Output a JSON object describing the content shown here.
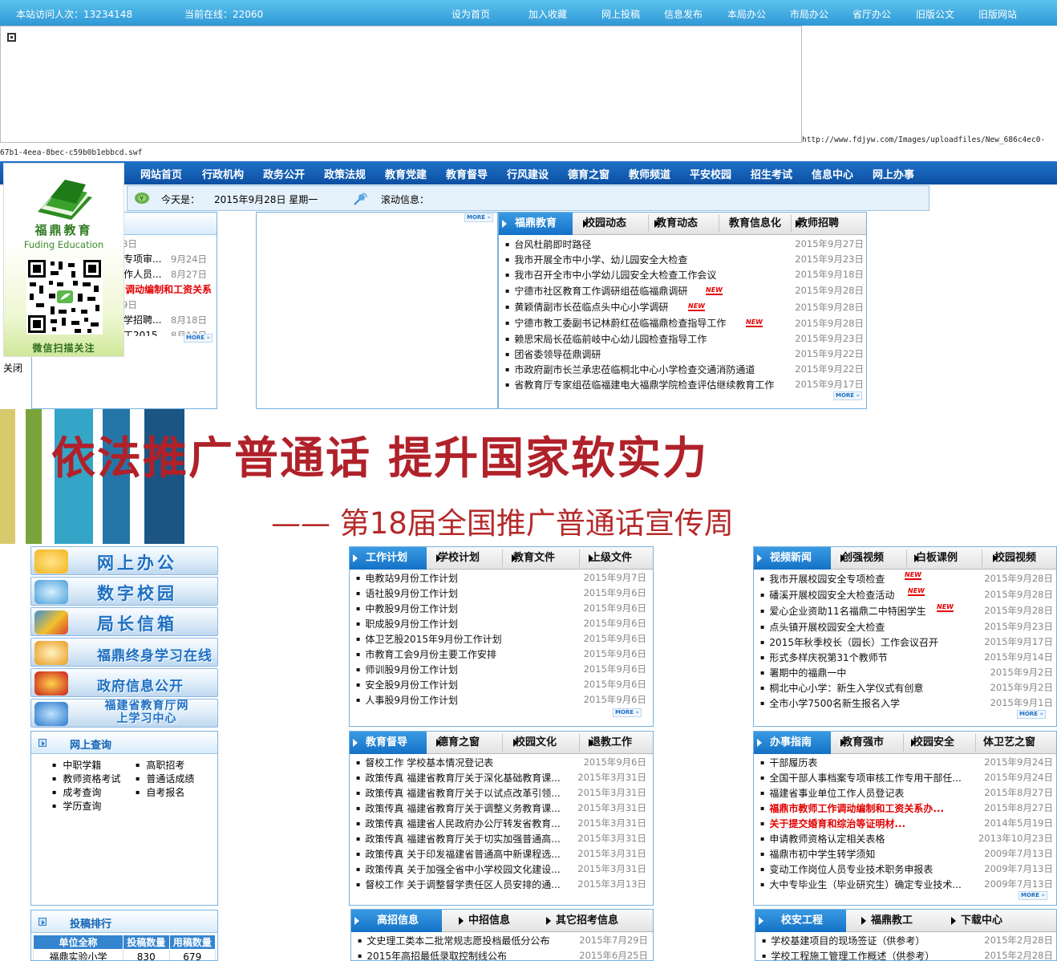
{
  "topbar": {
    "visits": "本站访问人次：13234148",
    "online": "当前在线：22060",
    "links": [
      "设为首页",
      "加入收藏",
      "网上投稿",
      "信息发布",
      "本局办公",
      "市局办公",
      "省厅办公",
      "旧版公文",
      "旧版网站"
    ]
  },
  "flash_url": {
    "part1": "http://www.fdjyw.com/Images/uploadfiles/New_686c4ec0-",
    "part2": "67b1-4eea-8bec-c59b0b1ebbcd.swf"
  },
  "nav": [
    "网站首页",
    "行政机构",
    "政务公开",
    "政策法规",
    "教育党建",
    "教育督导",
    "行风建设",
    "德育之窗",
    "教师频道",
    "平安校园",
    "招生考试",
    "信息中心",
    "网上办事"
  ],
  "datebar": {
    "today_label": "今天是：",
    "date": "2015年9月28日 星期一",
    "scroll_label": "滚动信息："
  },
  "float_ad": {
    "brand_cn": "福鼎教育",
    "brand_en": "Fuding Education",
    "scan_text": "微信扫描关注",
    "close": "关闭"
  },
  "left_notice": {
    "items": [
      {
        "t": "",
        "d": "8日"
      },
      {
        "t": "专项审...",
        "d": "9月24日"
      },
      {
        "t": "作人员...",
        "d": "8月27日"
      },
      {
        "t": "调动编制和工资关系",
        "d": "",
        "red": true
      },
      {
        "t": "",
        "d": "9日"
      },
      {
        "t": "学招聘...",
        "d": "8月18日"
      },
      {
        "t": "工2015...",
        "d": "8月17日"
      }
    ],
    "more": "MORE"
  },
  "middle_more": "MORE",
  "news": {
    "tabs": [
      "福鼎教育",
      "校园动态",
      "教育动态",
      "教育信息化",
      "教师招聘"
    ],
    "items": [
      {
        "t": "台风杜鹃即时路径",
        "d": "2015年9月27日"
      },
      {
        "t": "我市开展全市中小学、幼儿园安全大检查",
        "d": "2015年9月23日"
      },
      {
        "t": "我市召开全市中小学幼儿园安全大检查工作会议",
        "d": "2015年9月18日"
      },
      {
        "t": "宁德市社区教育工作调研组莅临福鼎调研",
        "d": "2015年9月28日",
        "new": true
      },
      {
        "t": "黄颖倩副市长莅临点头中心小学调研",
        "d": "2015年9月28日",
        "new": true
      },
      {
        "t": "宁德市教工委副书记林蔚红莅临福鼎检查指导工作",
        "d": "2015年9月28日",
        "new": true
      },
      {
        "t": "赖思宋局长莅临前岐中心幼儿园检查指导工作",
        "d": "2015年9月23日"
      },
      {
        "t": "团省委领导莅鼎调研",
        "d": "2015年9月22日"
      },
      {
        "t": "市政府副市长兰承忠莅临桐北中心小学检查交通消防通道",
        "d": "2015年9月22日"
      },
      {
        "t": "省教育厅专家组莅临福建电大福鼎学院检查评估继续教育工作",
        "d": "2015年9月17日"
      }
    ],
    "more": "MORE"
  },
  "new_label": "NEW",
  "banner": {
    "title": "依法推广普通话  提升国家软实力",
    "subtitle": "—— 第18届全国推广普通话宣传周"
  },
  "quick_buttons": [
    "网上办公",
    "数字校园",
    "局长信箱",
    "福鼎终身学习在线",
    "政府信息公开",
    "福建省教育厅网上学习中心"
  ],
  "online_query": {
    "title": "网上查询",
    "items": [
      "中职学籍",
      "高职招考",
      "教师资格考试",
      "普通话成绩",
      "成考查询",
      "自考报名",
      "学历查询"
    ]
  },
  "ranking": {
    "title": "投稿排行",
    "headers": [
      "单位全称",
      "投稿数量",
      "用稿数量"
    ],
    "rows": [
      [
        "福鼎实验小学",
        "830",
        "679"
      ]
    ]
  },
  "work_plan": {
    "tabs": [
      "工作计划",
      "学校计划",
      "教育文件",
      "上级文件"
    ],
    "items": [
      {
        "t": "电教站9月份工作计划",
        "d": "2015年9月7日"
      },
      {
        "t": "语社股9月份工作计划",
        "d": "2015年9月6日"
      },
      {
        "t": "中教股9月份工作计划",
        "d": "2015年9月6日"
      },
      {
        "t": "职成股9月份工作计划",
        "d": "2015年9月6日"
      },
      {
        "t": "体卫艺股2015年9月份工作计划",
        "d": "2015年9月6日"
      },
      {
        "t": "市教育工会9月份主要工作安排",
        "d": "2015年9月6日"
      },
      {
        "t": "师训股9月份工作计划",
        "d": "2015年9月6日"
      },
      {
        "t": "安全股9月份工作计划",
        "d": "2015年9月6日"
      },
      {
        "t": "人事股9月份工作计划",
        "d": "2015年9月6日"
      }
    ],
    "more": "MORE"
  },
  "video": {
    "tabs": [
      "视频新闻",
      "创强视频",
      "白板课例",
      "校园视频"
    ],
    "items": [
      {
        "t": "我市开展校园安全专项检查",
        "d": "2015年9月28日",
        "new": true
      },
      {
        "t": "磻溪开展校园安全大检查活动",
        "d": "2015年9月28日",
        "new": true
      },
      {
        "t": "爱心企业资助11名福鼎二中特困学生",
        "d": "2015年9月28日",
        "new": true
      },
      {
        "t": "点头镇开展校园安全大检查",
        "d": "2015年9月23日"
      },
      {
        "t": "2015年秋季校长（园长）工作会议召开",
        "d": "2015年9月17日"
      },
      {
        "t": "形式多样庆祝第31个教师节",
        "d": "2015年9月14日"
      },
      {
        "t": "署期中的福鼎一中",
        "d": "2015年9月2日"
      },
      {
        "t": "桐北中心小学：新生入学仪式有创意",
        "d": "2015年9月2日"
      },
      {
        "t": "全市小学7500名新生报名入学",
        "d": "2015年9月1日"
      }
    ],
    "more": "MORE"
  },
  "supervision": {
    "tabs": [
      "教育督导",
      "德育之窗",
      "校园文化",
      "退教工作"
    ],
    "items": [
      {
        "t": "督校工作  学校基本情况登记表",
        "d": "2015年9月6日"
      },
      {
        "t": "政策传真  福建省教育厅关于深化基础教育课...",
        "d": "2015年3月31日"
      },
      {
        "t": "政策传真  福建省教育厅关于以试点改革引领...",
        "d": "2015年3月31日"
      },
      {
        "t": "政策传真  福建省教育厅关于调整义务教育课...",
        "d": "2015年3月31日"
      },
      {
        "t": "政策传真  福建省人民政府办公厅转发省教育...",
        "d": "2015年3月31日"
      },
      {
        "t": "政策传真  福建省教育厅关于切实加强普通高...",
        "d": "2015年3月31日"
      },
      {
        "t": "政策传真  关于印发福建省普通高中新课程选...",
        "d": "2015年3月31日"
      },
      {
        "t": "政策传真  关于加强全省中小学校园文化建设...",
        "d": "2015年3月31日"
      },
      {
        "t": "督校工作  关于调整督学责任区人员安排的通...",
        "d": "2015年3月13日"
      }
    ]
  },
  "guide": {
    "tabs": [
      "办事指南",
      "教育强市",
      "校园安全",
      "体卫艺之窗"
    ],
    "items": [
      {
        "t": "干部履历表",
        "d": "2015年9月24日"
      },
      {
        "t": "全国干部人事档案专项审核工作专用干部任...",
        "d": "2015年9月24日"
      },
      {
        "t": "福建省事业单位工作人员登记表",
        "d": "2015年8月27日"
      },
      {
        "t": "福鼎市教师工作调动编制和工资关系办...",
        "d": "2015年8月27日",
        "red": true
      },
      {
        "t": "关于提交婚育和综治等证明材...",
        "d": "2014年5月19日",
        "red": true
      },
      {
        "t": "申请教师资格认定相关表格",
        "d": "2013年10月23日"
      },
      {
        "t": "福鼎市初中学生转学须知",
        "d": "2009年7月13日"
      },
      {
        "t": "变动工作岗位人员专业技术职务申报表",
        "d": "2009年7月13日"
      },
      {
        "t": "大中专毕业生（毕业研究生）确定专业技术...",
        "d": "2009年7月13日"
      }
    ],
    "more": "MORE"
  },
  "enroll": {
    "tabs": [
      "高招信息",
      "中招信息",
      "其它招考信息"
    ],
    "items": [
      {
        "t": "文史理工类本二批常规志愿投档最低分公布",
        "d": "2015年7月29日"
      },
      {
        "t": "2015年高招最低录取控制线公布",
        "d": "2015年6月25日"
      }
    ]
  },
  "school": {
    "tabs": [
      "校安工程",
      "福鼎教工",
      "下载中心"
    ],
    "items": [
      {
        "t": "学校基建项目的现场签证（供参考）",
        "d": "2015年2月28日"
      },
      {
        "t": "学校工程施工管理工作概述（供参考）",
        "d": "2015年2月28日"
      }
    ]
  },
  "colors": {
    "nav": "#0d4fa3",
    "topbar": "#2f98d6",
    "accent": "#1471c6",
    "red": "#e30000",
    "banner_red": "#b0212a"
  }
}
